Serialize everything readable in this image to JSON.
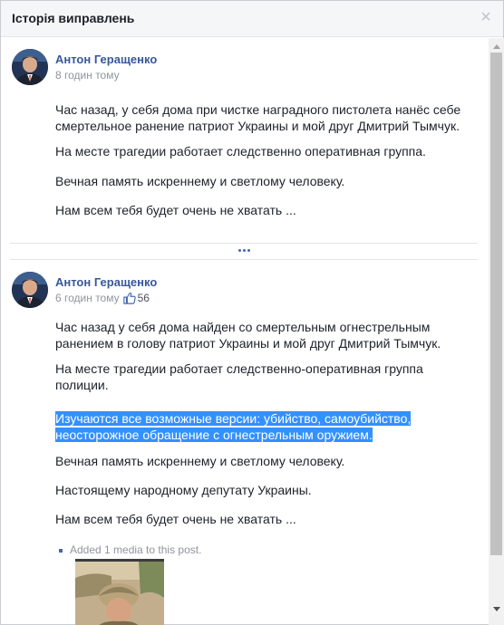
{
  "dialog": {
    "title": "Історія виправлень",
    "close_glyph": "×"
  },
  "posts": [
    {
      "author": "Антон Геращенко",
      "time": "8 годин тому",
      "paragraphs": [
        "Час назад, у себя дома при чистке наградного пистолета нанёс себе смертельное ранение патриот Украины и мой друг Дмитрий Тымчук.",
        "На месте трагедии работает следственно оперативная группа.",
        "Вечная память искреннему и светлому человеку.",
        "Нам всем тебя будет очень не хватать ..."
      ]
    },
    {
      "author": "Антон Геращенко",
      "time": "6 годин тому",
      "likes": "56",
      "paragraphs": [
        "Час назад у себя дома найден со смертельным огнестрельным ранением в голову патриот Украины и мой друг Дмитрий Тымчук.",
        "На месте трагедии работает следственно-оперативная группа полиции.",
        "Изучаются все возможные версии: убийство, самоубийство, неосторожное обращение с огнестрельным оружием.",
        "Вечная память искреннему и светлому человеку.",
        "Настоящему народному депутату Украины.",
        "Нам всем тебя будет очень не хватать ..."
      ],
      "change_log": "Added 1 media to this post."
    }
  ],
  "colors": {
    "link": "#365899",
    "muted": "#90949c",
    "highlight": "#3390ff",
    "header_bg": "#f5f6f7"
  },
  "icons": {
    "close": "close-icon",
    "like": "thumbs-up-icon",
    "more": "more-dots-icon",
    "scroll_up": "scroll-up-arrow-icon",
    "scroll_down": "scroll-down-arrow-icon"
  }
}
